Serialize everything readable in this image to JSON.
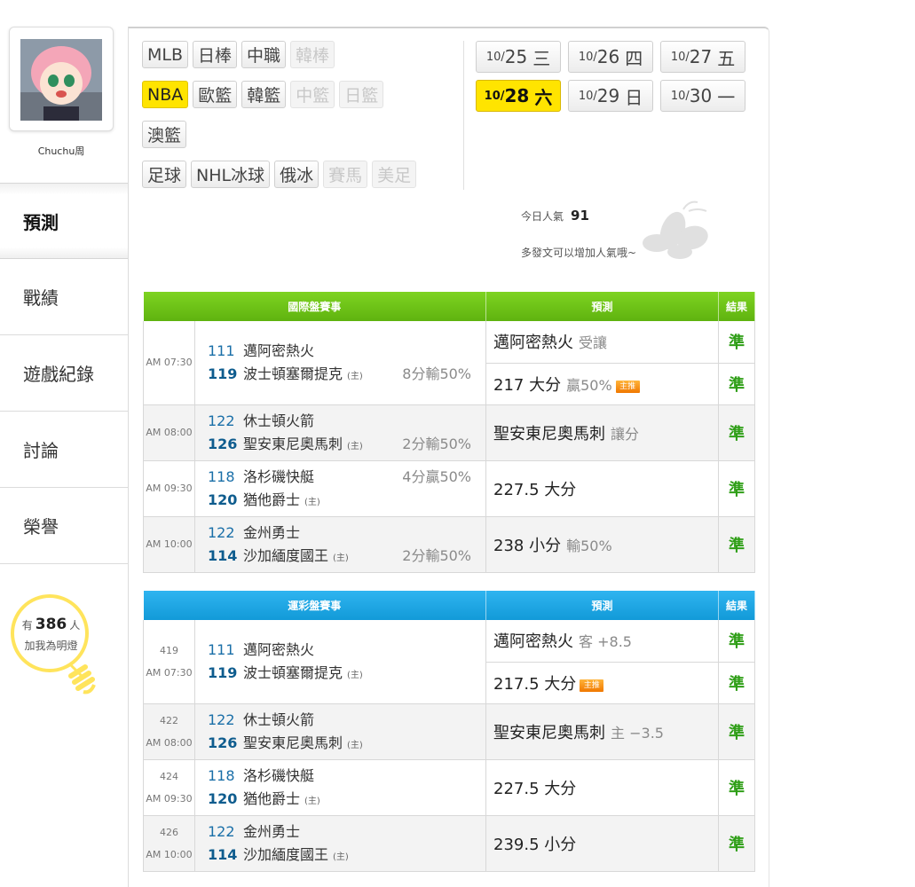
{
  "user": {
    "name": "Chuchu周"
  },
  "nav": [
    {
      "label": "預測",
      "active": true
    },
    {
      "label": "戰績",
      "active": false
    },
    {
      "label": "遊戲紀錄",
      "active": false
    },
    {
      "label": "討論",
      "active": false
    },
    {
      "label": "榮譽",
      "active": false
    }
  ],
  "fans": {
    "prefix": "有",
    "count": "386",
    "suffix": "人",
    "line2": "加我為明燈"
  },
  "sport_tabs": [
    [
      {
        "label": "MLB",
        "state": "normal"
      },
      {
        "label": "日棒",
        "state": "normal"
      },
      {
        "label": "中職",
        "state": "normal"
      },
      {
        "label": "韓棒",
        "state": "disabled"
      }
    ],
    [
      {
        "label": "NBA",
        "state": "active"
      },
      {
        "label": "歐籃",
        "state": "normal"
      },
      {
        "label": "韓籃",
        "state": "normal"
      },
      {
        "label": "中籃",
        "state": "disabled"
      },
      {
        "label": "日籃",
        "state": "disabled"
      }
    ],
    [
      {
        "label": "澳籃",
        "state": "normal"
      }
    ],
    [
      {
        "label": "足球",
        "state": "normal"
      },
      {
        "label": "NHL冰球",
        "state": "normal"
      },
      {
        "label": "俄冰",
        "state": "normal"
      },
      {
        "label": "賽馬",
        "state": "disabled"
      },
      {
        "label": "美足",
        "state": "disabled"
      }
    ]
  ],
  "date_tabs": [
    [
      {
        "month": "10/",
        "day": "25",
        "weekday": "三",
        "active": false
      },
      {
        "month": "10/",
        "day": "26",
        "weekday": "四",
        "active": false
      },
      {
        "month": "10/",
        "day": "27",
        "weekday": "五",
        "active": false
      }
    ],
    [
      {
        "month": "10/",
        "day": "28",
        "weekday": "六",
        "active": true
      },
      {
        "month": "10/",
        "day": "29",
        "weekday": "日",
        "active": false
      },
      {
        "month": "10/",
        "day": "30",
        "weekday": "一",
        "active": false
      }
    ]
  ],
  "popularity": {
    "label": "今日人氣",
    "value": "91",
    "hint": "多發文可以增加人氣哦~"
  },
  "home_mark": "(主)",
  "intl_table": {
    "headers": {
      "games": "國際盤賽事",
      "prediction": "預測",
      "result": "結果"
    },
    "games": [
      {
        "time": "AM 07:30",
        "teams": [
          {
            "no": "111",
            "name": "邁阿密熱火",
            "home": false
          },
          {
            "no": "119",
            "name": "波士頓塞爾提克",
            "home": true
          }
        ],
        "line": {
          "text": "8分輸50%",
          "row": 1
        },
        "preds": [
          {
            "main": "邁阿密熱火",
            "sub": "受讓",
            "badge": "",
            "result": "準"
          },
          {
            "main": "217 大分",
            "sub": "贏50%",
            "badge": "主推",
            "result": "準"
          }
        ]
      },
      {
        "time": "AM 08:00",
        "teams": [
          {
            "no": "122",
            "name": "休士頓火箭",
            "home": false
          },
          {
            "no": "126",
            "name": "聖安東尼奧馬刺",
            "home": true
          }
        ],
        "line": {
          "text": "2分輸50%",
          "row": 1
        },
        "preds": [
          {
            "main": "聖安東尼奧馬刺",
            "sub": "讓分",
            "badge": "",
            "result": "準"
          }
        ]
      },
      {
        "time": "AM 09:30",
        "teams": [
          {
            "no": "118",
            "name": "洛杉磯快艇",
            "home": false
          },
          {
            "no": "120",
            "name": "猶他爵士",
            "home": true
          }
        ],
        "line": {
          "text": "4分贏50%",
          "row": 0
        },
        "preds": [
          {
            "main": "227.5 大分",
            "sub": "",
            "badge": "",
            "result": "準"
          }
        ]
      },
      {
        "time": "AM 10:00",
        "teams": [
          {
            "no": "122",
            "name": "金州勇士",
            "home": false
          },
          {
            "no": "114",
            "name": "沙加緬度國王",
            "home": true
          }
        ],
        "line": {
          "text": "2分輸50%",
          "row": 1
        },
        "preds": [
          {
            "main": "238 小分",
            "sub": "輸50%",
            "badge": "",
            "result": "準"
          }
        ]
      }
    ]
  },
  "lottery_table": {
    "headers": {
      "games": "運彩盤賽事",
      "prediction": "預測",
      "result": "結果"
    },
    "games": [
      {
        "code": "419",
        "time": "AM 07:30",
        "teams": [
          {
            "no": "111",
            "name": "邁阿密熱火",
            "home": false
          },
          {
            "no": "119",
            "name": "波士頓塞爾提克",
            "home": true
          }
        ],
        "preds": [
          {
            "main": "邁阿密熱火",
            "sub": "客 +8.5",
            "badge": "",
            "result": "準"
          },
          {
            "main": "217.5 大分",
            "sub": "",
            "badge": "主推",
            "result": "準"
          }
        ]
      },
      {
        "code": "422",
        "time": "AM 08:00",
        "teams": [
          {
            "no": "122",
            "name": "休士頓火箭",
            "home": false
          },
          {
            "no": "126",
            "name": "聖安東尼奧馬刺",
            "home": true
          }
        ],
        "preds": [
          {
            "main": "聖安東尼奧馬刺",
            "sub": "主 −3.5",
            "badge": "",
            "result": "準"
          }
        ]
      },
      {
        "code": "424",
        "time": "AM 09:30",
        "teams": [
          {
            "no": "118",
            "name": "洛杉磯快艇",
            "home": false
          },
          {
            "no": "120",
            "name": "猶他爵士",
            "home": true
          }
        ],
        "preds": [
          {
            "main": "227.5 大分",
            "sub": "",
            "badge": "",
            "result": "準"
          }
        ]
      },
      {
        "code": "426",
        "time": "AM 10:00",
        "teams": [
          {
            "no": "122",
            "name": "金州勇士",
            "home": false
          },
          {
            "no": "114",
            "name": "沙加緬度國王",
            "home": true
          }
        ],
        "preds": [
          {
            "main": "239.5 小分",
            "sub": "",
            "badge": "",
            "result": "準"
          }
        ]
      }
    ]
  }
}
